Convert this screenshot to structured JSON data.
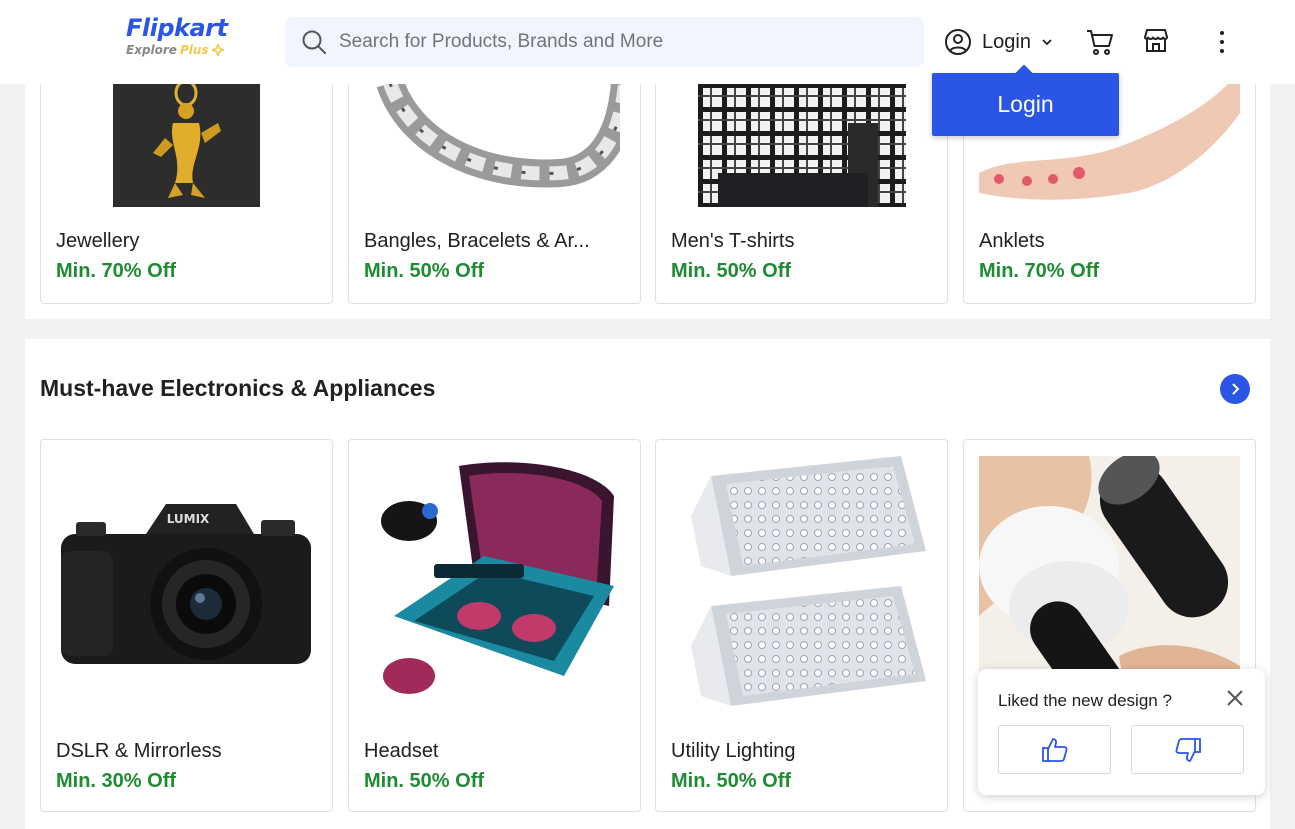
{
  "header": {
    "logo_text": "Flipkart",
    "logo_sub": "Explore",
    "logo_plus": "Plus",
    "search_placeholder": "Search for Products, Brands and More",
    "login_label": "Login",
    "login_popup_label": "Login"
  },
  "fashion": {
    "cards": [
      {
        "name": "Jewellery",
        "offer": "Min. 70% Off"
      },
      {
        "name": "Bangles, Bracelets & Ar...",
        "offer": "Min. 50% Off"
      },
      {
        "name": "Men's T-shirts",
        "offer": "Min. 50% Off"
      },
      {
        "name": "Anklets",
        "offer": "Min. 70% Off"
      }
    ]
  },
  "electronics": {
    "title": "Must-have Electronics & Appliances",
    "cards": [
      {
        "name": "DSLR & Mirrorless",
        "offer": "Min. 30% Off"
      },
      {
        "name": "Headset",
        "offer": "Min. 50% Off"
      },
      {
        "name": "Utility Lighting",
        "offer": "Min. 50% Off"
      },
      {
        "name": "",
        "offer": ""
      }
    ]
  },
  "feedback": {
    "question": "Liked the new design ?"
  },
  "colors": {
    "brand": "#2a55e5",
    "offer_green": "#1f8b32",
    "page_bg": "#f1f2f4"
  }
}
